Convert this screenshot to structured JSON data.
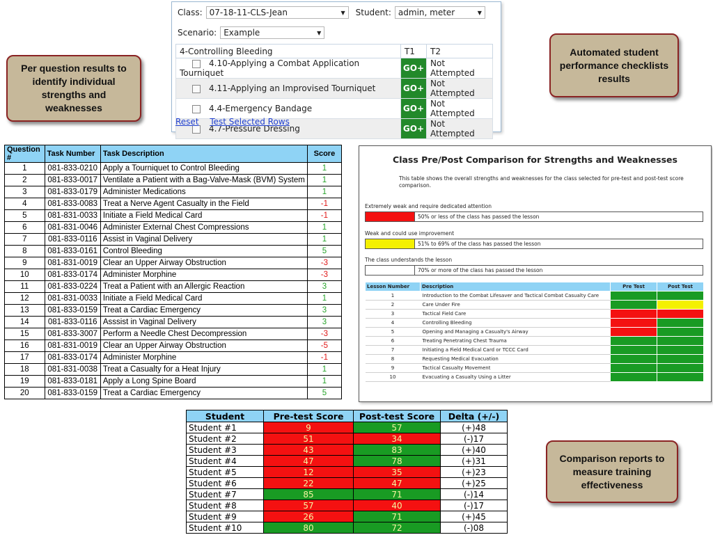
{
  "callouts": {
    "per_question": "Per question results to  identify individual strengths and weaknesses",
    "automated": "Automated student performance checklists results",
    "comparison": "Comparison reports to measure training effectiveness"
  },
  "checklist": {
    "class_label": "Class:",
    "class_value": "07-18-11-CLS-Jean",
    "student_label": "Student:",
    "student_value": "admin, meter",
    "scenario_label": "Scenario:",
    "scenario_value": "Example",
    "table_header": {
      "task": "4-Controlling Bleeding",
      "t1": "T1",
      "t2": "T2"
    },
    "rows": [
      {
        "task": "4.10-Applying a Combat Application Tourniquet",
        "t1": "GO+",
        "t2": "Not Attempted"
      },
      {
        "task": "4.11-Applying an Improvised Tourniquet",
        "t1": "GO+",
        "t2": "Not Attempted"
      },
      {
        "task": "4.4-Emergency Bandage",
        "t1": "GO+",
        "t2": "Not Attempted"
      },
      {
        "task": "4.7-Pressure Dressing",
        "t1": "GO+",
        "t2": "Not Attempted"
      }
    ],
    "reset_link": "Reset",
    "test_link": "Test Selected Rows"
  },
  "questions": {
    "headers": [
      "Question #",
      "Task Number",
      "Task Description",
      "Score"
    ],
    "rows": [
      [
        "1",
        "081-833-0210",
        "Apply a Tourniquet to Control Bleeding",
        "1"
      ],
      [
        "2",
        "081-833-0017",
        "Ventilate a Patient with a Bag-Valve-Mask (BVM) System",
        "1"
      ],
      [
        "3",
        "081-833-0179",
        "Administer Medications",
        "1"
      ],
      [
        "4",
        "081-833-0083",
        "Treat a Nerve Agent Casualty in the Field",
        "-1"
      ],
      [
        "5",
        "081-831-0033",
        "Initiate a Field Medical Card",
        "-1"
      ],
      [
        "6",
        "081-831-0046",
        "Administer External Chest Compressions",
        "1"
      ],
      [
        "7",
        "081-833-0116",
        "Assist in Vaginal Delivery",
        "1"
      ],
      [
        "8",
        "081-833-0161",
        "Control Bleeding",
        "5"
      ],
      [
        "9",
        "081-831-0019",
        "Clear an Upper Airway Obstruction",
        "-3"
      ],
      [
        "10",
        "081-833-0174",
        "Administer Morphine",
        "-3"
      ],
      [
        "11",
        "081-833-0224",
        "Treat a Patient with an Allergic Reaction",
        "3"
      ],
      [
        "12",
        "081-831-0033",
        "Initiate a Field Medical Card",
        "1"
      ],
      [
        "13",
        "081-833-0159",
        "Treat a Cardiac Emergency",
        "3"
      ],
      [
        "14",
        "081-833-0116",
        "Asssist in Vaginal Delivery",
        "3"
      ],
      [
        "15",
        "081-833-3007",
        "Perform a Needle Chest Decompression",
        "-3"
      ],
      [
        "16",
        "081-831-0019",
        "Clear an Upper Airway Obstruction",
        "-5"
      ],
      [
        "17",
        "081-833-0174",
        "Administer Morphine",
        "-1"
      ],
      [
        "18",
        "081-831-0038",
        "Treat a Casualty for a Heat Injury",
        "1"
      ],
      [
        "19",
        "081-833-0181",
        "Apply a Long Spine Board",
        "1"
      ],
      [
        "20",
        "081-833-0159",
        "Treat a Cardiac Emergency",
        "5"
      ]
    ]
  },
  "comparison": {
    "title": "Class Pre/Post Comparison for Strengths and Weaknesses",
    "description": "This table shows the overall strengths and weaknesses for the class selected for pre-test and post-test score comparison.",
    "legend": [
      {
        "label": "Extremely weak and require dedicated attention",
        "text": "50% or less of the class has passed the lesson",
        "color": "#f41111"
      },
      {
        "label": "Weak and could use improvement",
        "text": "51% to 69% of the class has passed the lesson",
        "color": "#f4f000"
      },
      {
        "label": "The class understands the lesson",
        "text": "70% or more of the class has passed the lesson",
        "color": "#ffffff"
      }
    ],
    "headers": [
      "Lesson Number",
      "Description",
      "Pre Test",
      "Post Test"
    ],
    "lessons": [
      {
        "num": "1",
        "desc": "Introduction to the Combat Lifesaver and Tactical Combat Casualty Care",
        "pre": "green",
        "post": "green"
      },
      {
        "num": "2",
        "desc": "Care Under Fire",
        "pre": "green",
        "post": "yellow"
      },
      {
        "num": "3",
        "desc": "Tactical Field Care",
        "pre": "red",
        "post": "red"
      },
      {
        "num": "4",
        "desc": "Controlling Bleeding",
        "pre": "red",
        "post": "green"
      },
      {
        "num": "5",
        "desc": "Opening and Managing a Casualty's Airway",
        "pre": "red",
        "post": "green"
      },
      {
        "num": "6",
        "desc": "Treating Penetrating Chest Trauma",
        "pre": "green",
        "post": "green"
      },
      {
        "num": "7",
        "desc": "Initiating a Field Medical Card or TCCC Card",
        "pre": "green",
        "post": "green"
      },
      {
        "num": "8",
        "desc": "Requesting Medical Evacuation",
        "pre": "green",
        "post": "green"
      },
      {
        "num": "9",
        "desc": "Tactical Casualty Movement",
        "pre": "green",
        "post": "green"
      },
      {
        "num": "10",
        "desc": "Evacuating a Casualty Using a Litter",
        "pre": "green",
        "post": "green"
      }
    ]
  },
  "students": {
    "headers": [
      "Student",
      "Pre-test Score",
      "Post-test Score",
      "Delta (+/-)"
    ],
    "rows": [
      {
        "name": "Student #1",
        "pre": "9",
        "pre_color": "red",
        "post": "57",
        "post_color": "green",
        "delta": "(+)48"
      },
      {
        "name": "Student #2",
        "pre": "51",
        "pre_color": "red",
        "post": "34",
        "post_color": "red",
        "delta": "(-)17"
      },
      {
        "name": "Student #3",
        "pre": "43",
        "pre_color": "red",
        "post": "83",
        "post_color": "green",
        "delta": "(+)40"
      },
      {
        "name": "Student #4",
        "pre": "47",
        "pre_color": "red",
        "post": "78",
        "post_color": "green",
        "delta": "(+)31"
      },
      {
        "name": "Student #5",
        "pre": "12",
        "pre_color": "red",
        "post": "35",
        "post_color": "red",
        "delta": "(+)23"
      },
      {
        "name": "Student #6",
        "pre": "22",
        "pre_color": "red",
        "post": "47",
        "post_color": "red",
        "delta": "(+)25"
      },
      {
        "name": "Student #7",
        "pre": "85",
        "pre_color": "green",
        "post": "71",
        "post_color": "green",
        "delta": "(-)14"
      },
      {
        "name": "Student #8",
        "pre": "57",
        "pre_color": "red",
        "post": "40",
        "post_color": "red",
        "delta": "(-)17"
      },
      {
        "name": "Student #9",
        "pre": "26",
        "pre_color": "red",
        "post": "71",
        "post_color": "green",
        "delta": "(+)45"
      },
      {
        "name": "Student #10",
        "pre": "80",
        "pre_color": "green",
        "post": "72",
        "post_color": "green",
        "delta": "(-)08"
      }
    ]
  },
  "colors": {
    "red": "#f41111",
    "green": "#199b23",
    "yellow": "#f4f000",
    "header_blue": "#8fd3f5",
    "go_green": "#22892a",
    "callout_bg": "#c6b89a"
  }
}
